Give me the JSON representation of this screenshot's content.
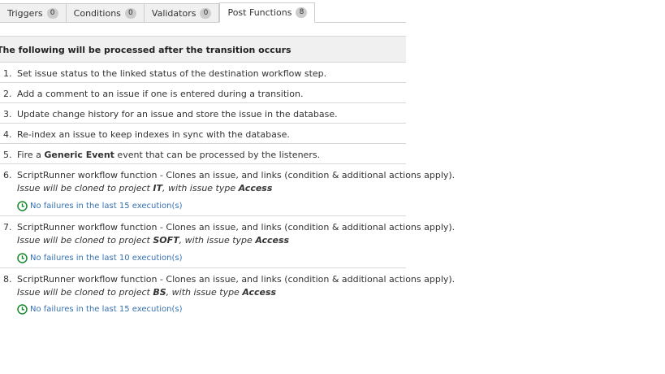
{
  "tabs": [
    {
      "label": "Triggers",
      "count": "0"
    },
    {
      "label": "Conditions",
      "count": "0"
    },
    {
      "label": "Validators",
      "count": "0"
    },
    {
      "label": "Post Functions",
      "count": "8"
    }
  ],
  "section": {
    "title": "The following will be processed after the transition occurs"
  },
  "functions": [
    {
      "num": "1.",
      "text": "Set issue status to the linked status of the destination workflow step."
    },
    {
      "num": "2.",
      "text": "Add a comment to an issue if one is entered during a transition."
    },
    {
      "num": "3.",
      "text": "Update change history for an issue and store the issue in the database."
    },
    {
      "num": "4.",
      "text": "Re-index an issue to keep indexes in sync with the database."
    },
    {
      "num": "5.",
      "text_before": "Fire a ",
      "event_name": "Generic Event",
      "text_after": " event that can be processed by the listeners."
    },
    {
      "num": "6.",
      "text": "ScriptRunner workflow function - Clones an issue, and links (condition & additional actions apply).",
      "sub_before": "Issue will be cloned to project ",
      "project": "IT",
      "sub_mid": ", with issue type ",
      "issue_type": "Access",
      "status": "No failures in the last 15 execution(s)"
    },
    {
      "num": "7.",
      "text": "ScriptRunner workflow function - Clones an issue, and links (condition & additional actions apply).",
      "sub_before": "Issue will be cloned to project ",
      "project": "SOFT",
      "sub_mid": ", with issue type ",
      "issue_type": "Access",
      "status": "No failures in the last 10 execution(s)"
    },
    {
      "num": "8.",
      "text": "ScriptRunner workflow function - Clones an issue, and links (condition & additional actions apply).",
      "sub_before": "Issue will be cloned to project ",
      "project": "BS",
      "sub_mid": ", with issue type ",
      "issue_type": "Access",
      "status": "No failures in the last 15 execution(s)"
    }
  ],
  "icons": {
    "status": "clock-icon"
  },
  "colors": {
    "status_text": "#3572b0",
    "status_icon": "#14892c",
    "header_bg": "#f0f0f0"
  }
}
